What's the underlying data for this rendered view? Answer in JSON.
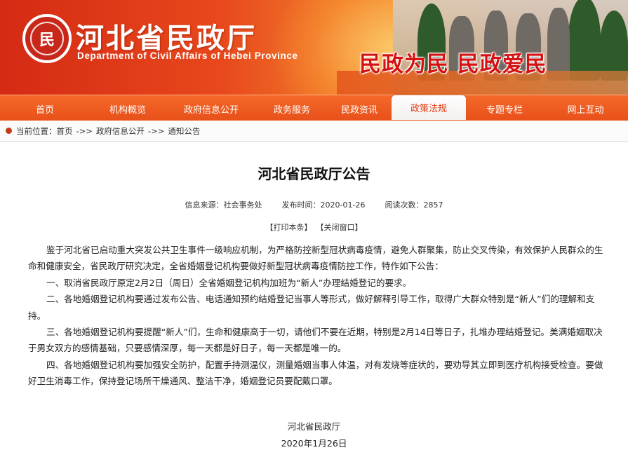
{
  "header": {
    "title_cn": "河北省民政厅",
    "title_en": "Department of Civil Affairs of Hebei Province",
    "slogan": "民政为民  民政爱民",
    "logo_icon": "emblem-icon",
    "logo_glyph": "民"
  },
  "nav": {
    "items": [
      {
        "label": "首页"
      },
      {
        "label": "机构概览"
      },
      {
        "label": "政府信息公开"
      },
      {
        "label": "政务服务"
      },
      {
        "label": "民政资讯"
      },
      {
        "label": "政策法规"
      },
      {
        "label": "专题专栏"
      },
      {
        "label": "网上互动"
      }
    ],
    "active_index": 5,
    "colors": {
      "bar": "#e8501a",
      "active_text": "#e23a12"
    }
  },
  "breadcrumb": {
    "prefix": "当前位置：",
    "items": [
      "首页",
      "政府信息公开",
      "通知公告"
    ],
    "separator": "->>"
  },
  "article": {
    "title": "河北省民政厅公告",
    "source_label": "信息来源：",
    "source": "社会事务处",
    "date_label": "发布时间：",
    "date": "2020-01-26",
    "views_label": "阅读次数：",
    "views": "2857",
    "print_label": "【打印本条】",
    "close_label": "【关闭窗口】",
    "paragraphs": [
      "鉴于河北省已启动重大突发公共卫生事件一级响应机制，为严格防控新型冠状病毒疫情，避免人群聚集，防止交叉传染，有效保护人民群众的生命和健康安全，省民政厅研究决定，全省婚姻登记机构要做好新型冠状病毒疫情防控工作，特作如下公告：",
      "一、取消省民政厅原定2月2日（周日）全省婚姻登记机构加班为“新人”办理结婚登记的要求。",
      "二、各地婚姻登记机构要通过发布公告、电话通知预约结婚登记当事人等形式，做好解释引导工作，取得广大群众特别是“新人”们的理解和支持。",
      "三、各地婚姻登记机构要提醒“新人”们，生命和健康高于一切，请他们不要在近期，特别是2月14日等日子，扎堆办理结婚登记。美满婚姻取决于男女双方的感情基础，只要感情深厚，每一天都是好日子，每一天都是唯一的。",
      "四、各地婚姻登记机构要加强安全防护，配置手持测温仪，测量婚姻当事人体温，对有发烧等症状的，要劝导其立即到医疗机构接受检查。要做好卫生消毒工作，保持登记场所干燥通风、整洁干净，婚姻登记员要配戴口罩。"
    ],
    "signature": "河北省民政厅",
    "sign_date": "2020年1月26日"
  }
}
